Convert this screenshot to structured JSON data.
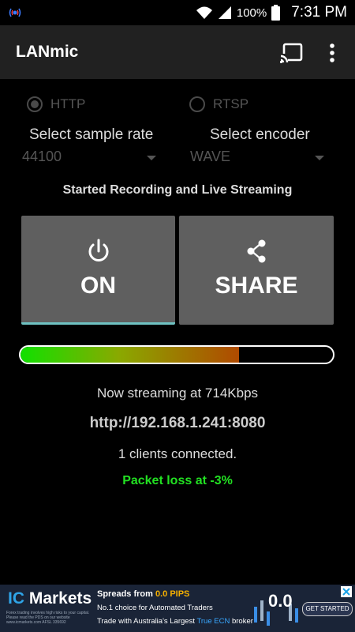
{
  "statusbar": {
    "battery_percent": "100%",
    "time": "7:31 PM"
  },
  "appbar": {
    "title": "LANmic",
    "icons": [
      "cast-icon",
      "overflow-menu-icon"
    ]
  },
  "protocol": {
    "options": [
      {
        "label": "HTTP",
        "checked": true
      },
      {
        "label": "RTSP",
        "checked": false
      }
    ]
  },
  "sample_rate": {
    "label": "Select sample rate",
    "value": "44100"
  },
  "encoder": {
    "label": "Select encoder",
    "value": "WAVE"
  },
  "status_message": "Started Recording and Live Streaming",
  "buttons": {
    "on_label": "ON",
    "share_label": "SHARE"
  },
  "level_meter": {
    "fill_fraction": 0.7
  },
  "stream_info": {
    "rate": "Now streaming at 714Kbps",
    "url": "http://192.168.1.241:8080",
    "clients": "1 clients connected.",
    "packet_loss": "Packet loss at -3%"
  },
  "ad": {
    "brand_prefix": "IC",
    "brand_rest": " Markets",
    "small_print": "Forex trading involves high risks to your capital. Please read the PDS on our website www.icmarkets.com AFSL 335692",
    "line1_text": "Spreads from ",
    "line1_highlight": "0.0 PIPS",
    "line2": "No.1 choice for Automated Traders",
    "line3_text": "Trade with Australia's Largest ",
    "line3_highlight": "True ECN",
    "line3_end": " broker",
    "graphic_text": "0.0",
    "cta": "GET STARTED"
  },
  "colors": {
    "appbar": "#212121",
    "button_bg": "#5f5f5f",
    "on_underline": "#6fc2c2",
    "packet_loss": "#22e022"
  }
}
